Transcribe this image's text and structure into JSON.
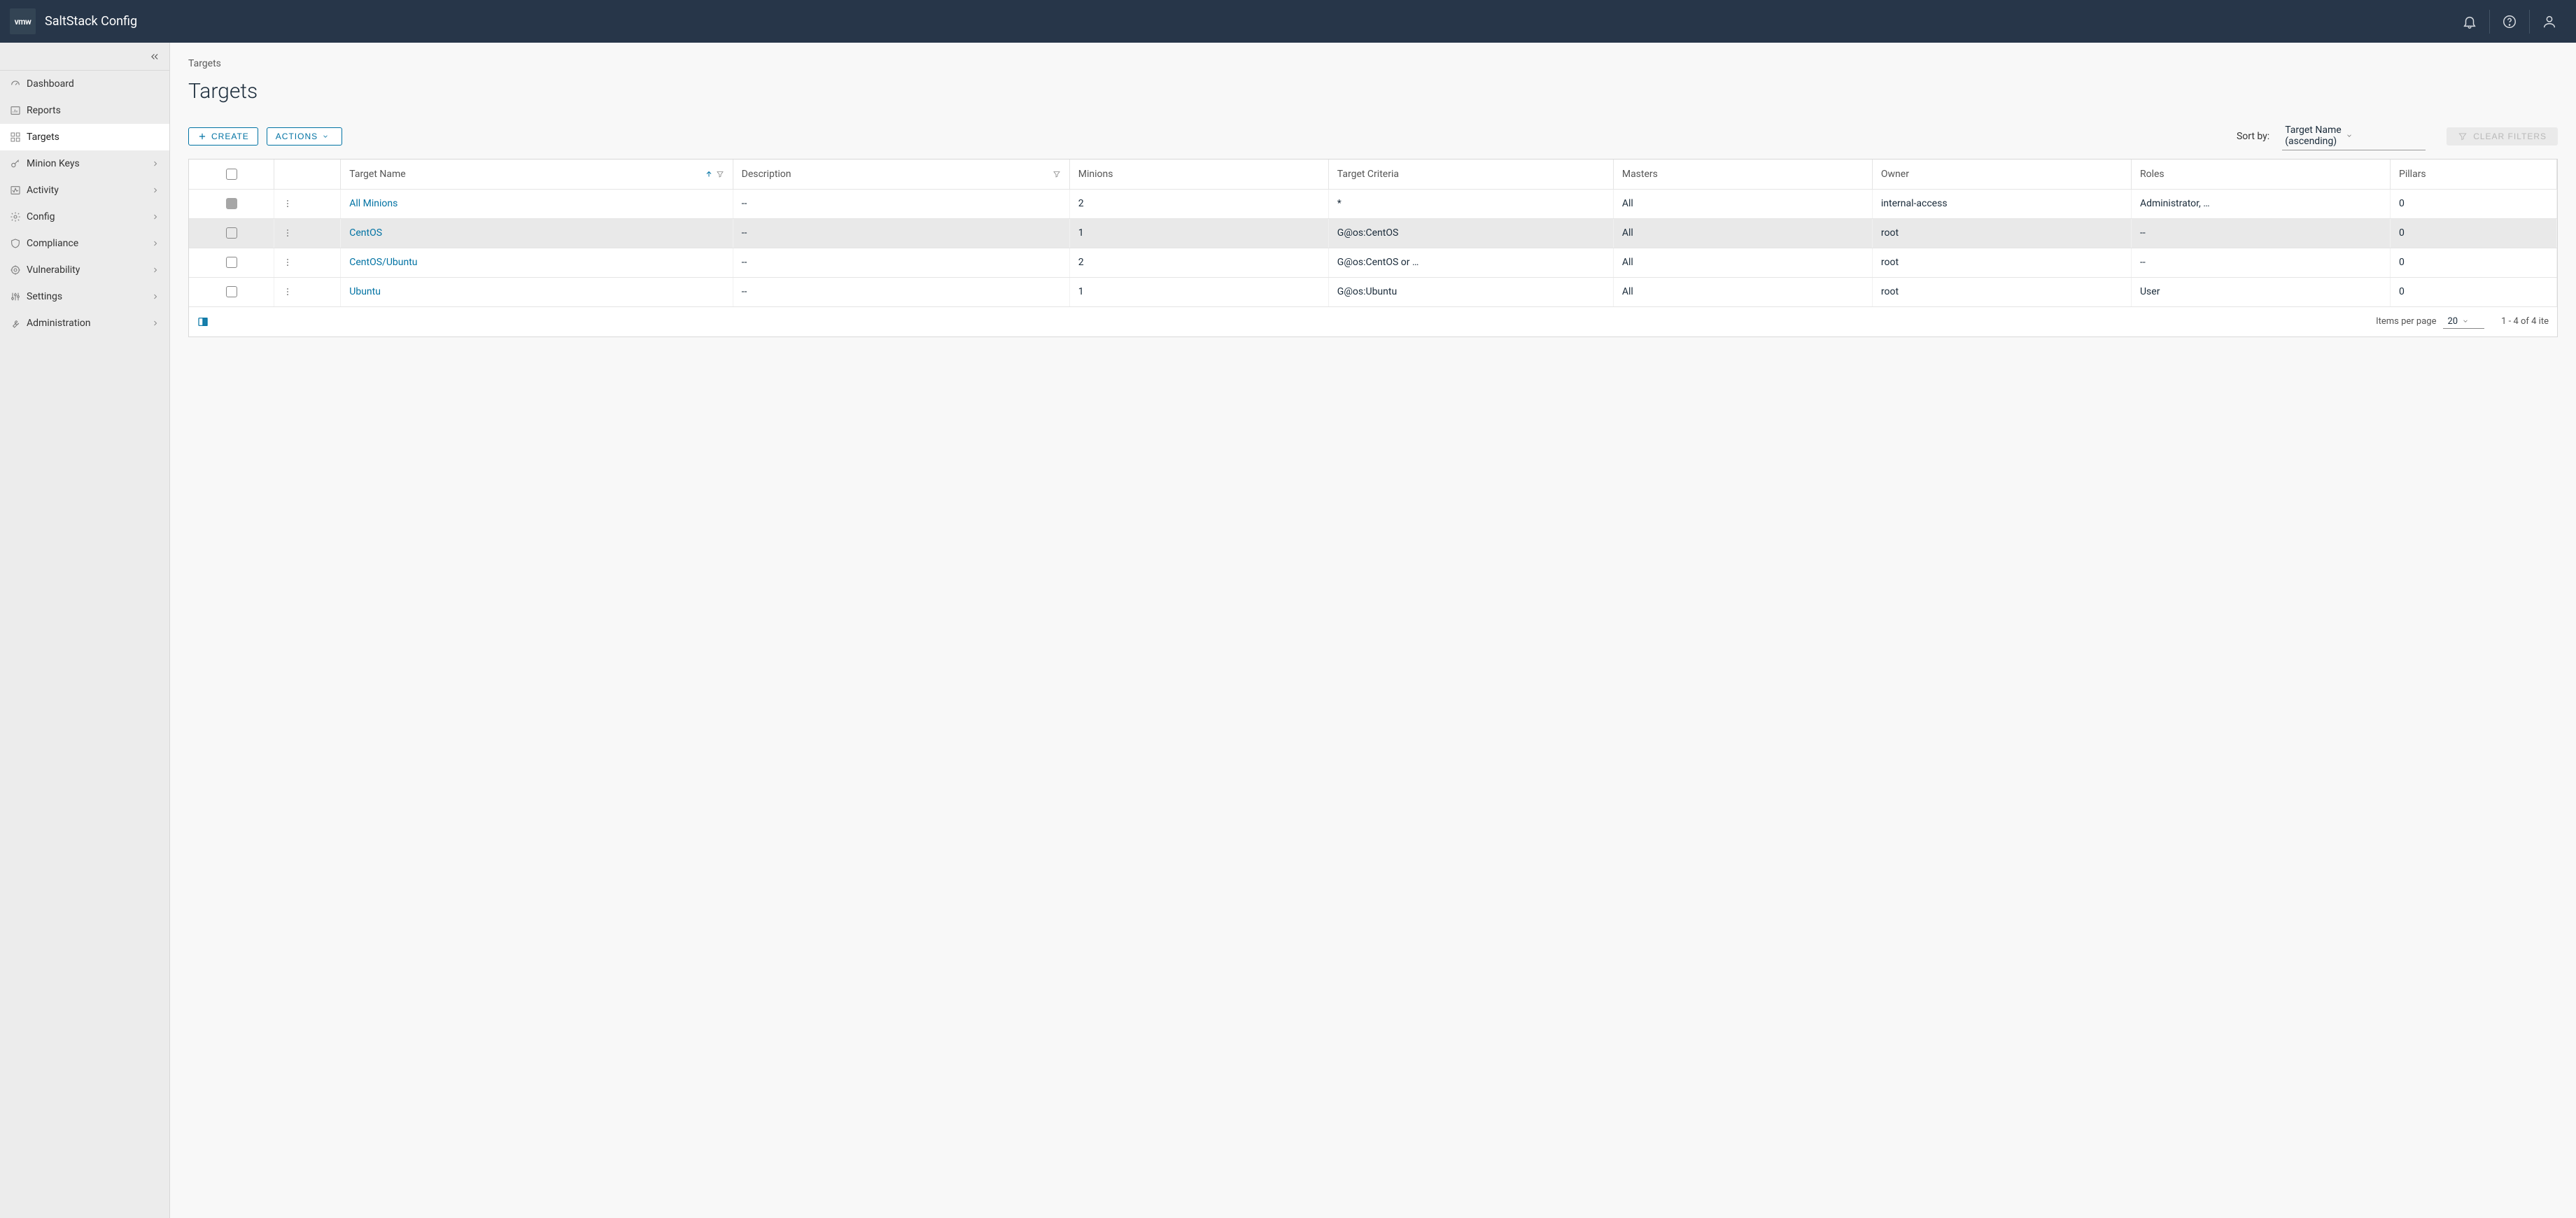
{
  "header": {
    "logo_text": "vmw",
    "title": "SaltStack Config"
  },
  "sidebar": {
    "items": [
      {
        "label": "Dashboard"
      },
      {
        "label": "Reports"
      },
      {
        "label": "Targets"
      },
      {
        "label": "Minion Keys"
      },
      {
        "label": "Activity"
      },
      {
        "label": "Config"
      },
      {
        "label": "Compliance"
      },
      {
        "label": "Vulnerability"
      },
      {
        "label": "Settings"
      },
      {
        "label": "Administration"
      }
    ]
  },
  "page": {
    "breadcrumb": "Targets",
    "title": "Targets"
  },
  "toolbar": {
    "create_label": "CREATE",
    "actions_label": "ACTIONS",
    "sortby_label": "Sort by:",
    "sortby_value": "Target Name (ascending)",
    "clear_label": "CLEAR FILTERS"
  },
  "table": {
    "headers": {
      "name": "Target Name",
      "desc": "Description",
      "minions": "Minions",
      "criteria": "Target Criteria",
      "masters": "Masters",
      "owner": "Owner",
      "roles": "Roles",
      "pillars": "Pillars"
    },
    "rows": [
      {
        "name": "All Minions",
        "desc": "--",
        "minions": "2",
        "criteria": "*",
        "masters": "All",
        "owner": "internal-access",
        "roles": "Administrator, …",
        "pillars": "0"
      },
      {
        "name": "CentOS",
        "desc": "--",
        "minions": "1",
        "criteria": "G@os:CentOS",
        "masters": "All",
        "owner": "root",
        "roles": "--",
        "pillars": "0"
      },
      {
        "name": "CentOS/Ubuntu",
        "desc": "--",
        "minions": "2",
        "criteria": "G@os:CentOS or …",
        "masters": "All",
        "owner": "root",
        "roles": "--",
        "pillars": "0"
      },
      {
        "name": "Ubuntu",
        "desc": "--",
        "minions": "1",
        "criteria": "G@os:Ubuntu",
        "masters": "All",
        "owner": "root",
        "roles": "User",
        "pillars": "0"
      }
    ]
  },
  "footer": {
    "ipp_label": "Items per page",
    "ipp_value": "20",
    "range": "1 - 4 of 4 ite"
  }
}
